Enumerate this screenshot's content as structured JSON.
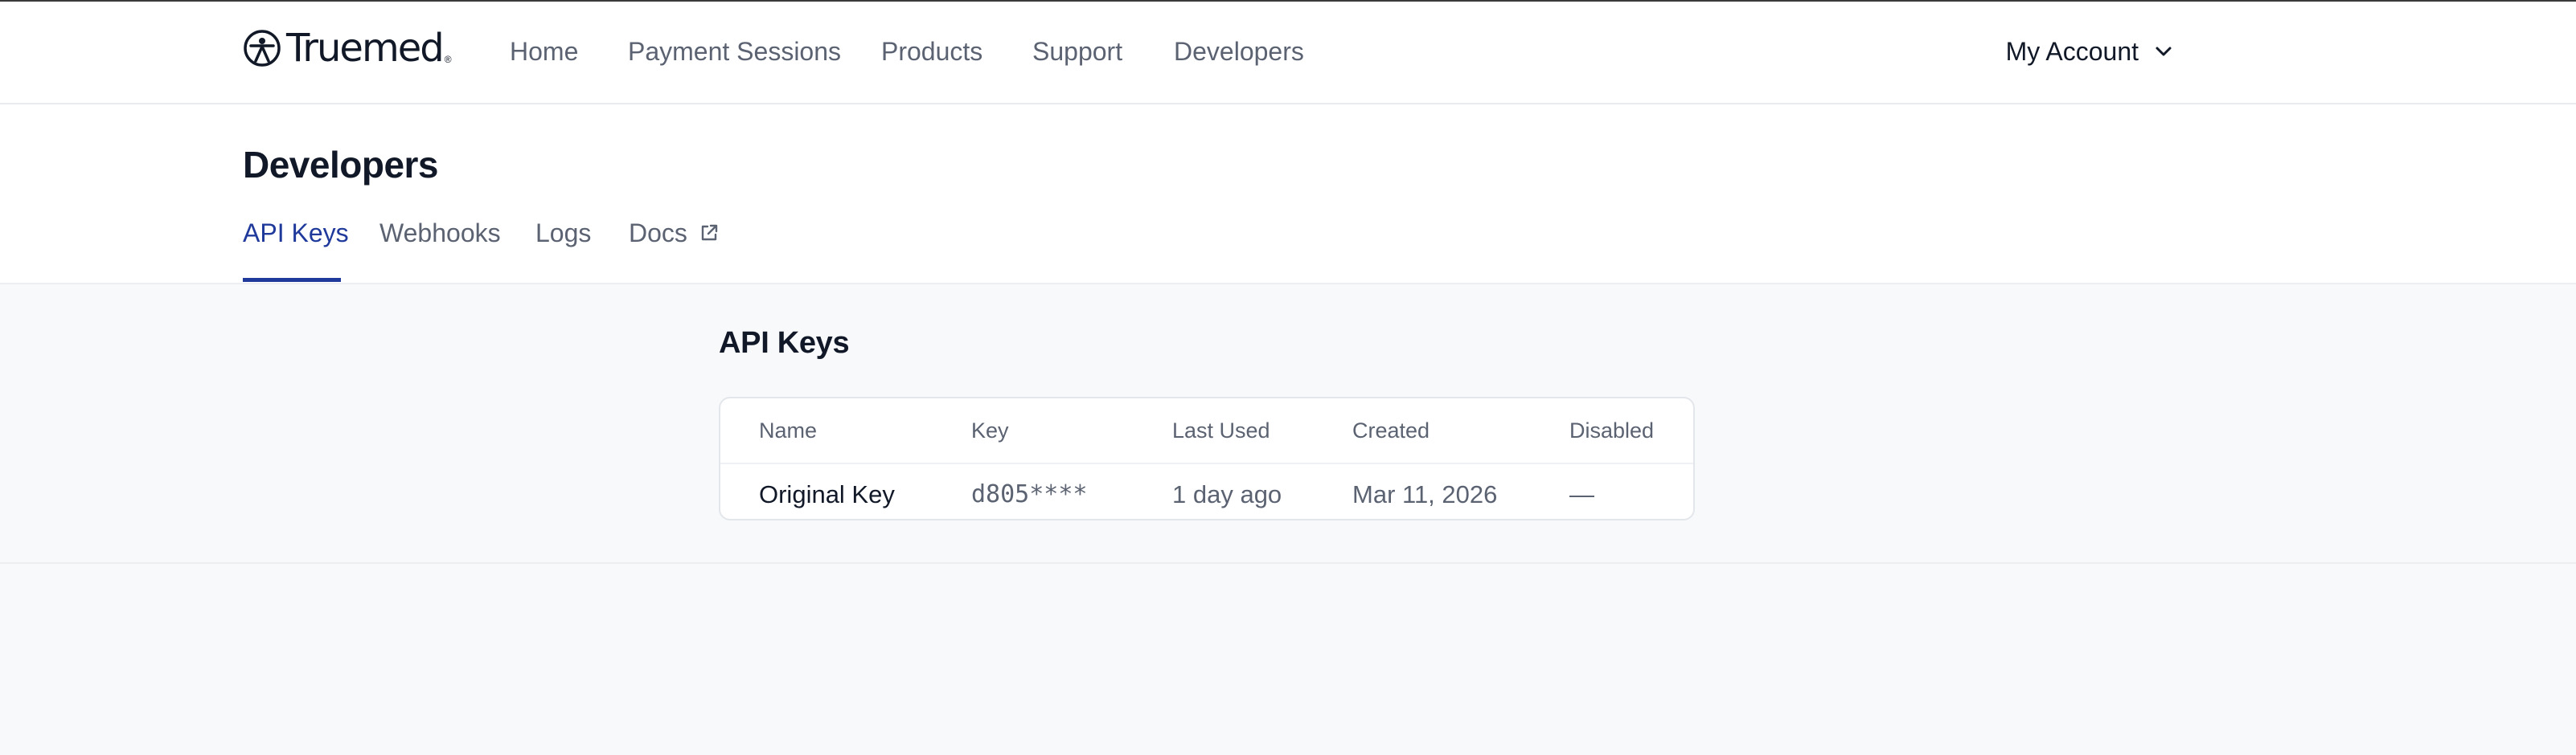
{
  "brand": {
    "name": "Truemed",
    "trademark": "®"
  },
  "nav": {
    "items": [
      {
        "label": "Home"
      },
      {
        "label": "Payment Sessions"
      },
      {
        "label": "Products"
      },
      {
        "label": "Support"
      },
      {
        "label": "Developers"
      }
    ],
    "account_label": "My Account"
  },
  "page": {
    "title": "Developers",
    "tabs": [
      {
        "label": "API Keys",
        "active": true
      },
      {
        "label": "Webhooks",
        "active": false
      },
      {
        "label": "Logs",
        "active": false
      },
      {
        "label": "Docs",
        "active": false,
        "icon": "external-link-icon"
      }
    ]
  },
  "api_keys": {
    "title": "API Keys",
    "columns": [
      "Name",
      "Key",
      "Last Used",
      "Created",
      "Disabled"
    ],
    "rows": [
      {
        "name": "Original Key",
        "key": "d805****",
        "last_used": "1 day ago",
        "created": "Mar 11, 2026",
        "disabled": "—"
      }
    ]
  },
  "colors": {
    "accent": "#1f3a9b",
    "text": "#111827",
    "muted": "#5b6271",
    "background": "#f8f9fb"
  }
}
